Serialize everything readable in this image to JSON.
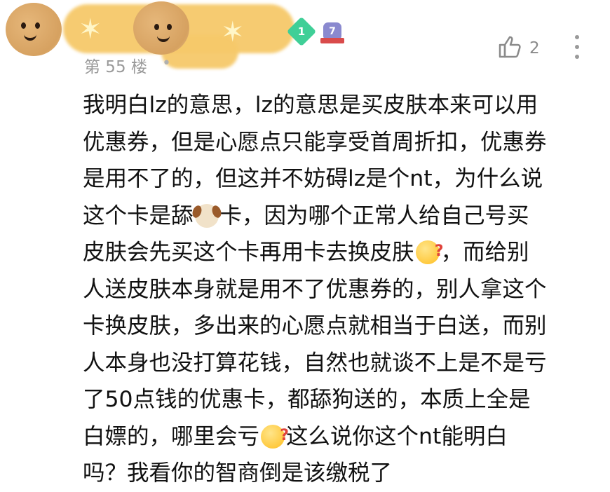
{
  "post": {
    "floor": "第 55 楼",
    "level_badge": "1",
    "rank_badge": "7",
    "likes": "2"
  },
  "body_lines": [
    [
      "我明白lz的意思，lz的意思是买皮肤本来可以用"
    ],
    [
      "优惠券，但是心愿点只能享受首周折扣，优惠券"
    ],
    [
      "是用不了的，但这并不妨碍lz是个nt，为什么说"
    ],
    [
      "这个卡是舔",
      "卡，因为哪个正常人给自己号买"
    ],
    [
      "皮肤会先买这个卡再用卡去换皮肤",
      "，而给别"
    ],
    [
      "人送皮肤本身就是用不了优惠券的，别人拿这个"
    ],
    [
      "卡换皮肤，多出来的心愿点就相当于白送，而别"
    ],
    [
      "人本身也没打算花钱，自然也就谈不上是不是亏"
    ],
    [
      "了50点钱的优惠卡，都舔狗送的，本质上全是"
    ],
    [
      "白嫖的，哪里会亏",
      "这么说你这个nt能明白"
    ],
    [
      "吗？我看你的智商倒是该缴税了"
    ]
  ],
  "icons": {
    "dog": "dog-face-emoji",
    "thinking": "thinking-face-emoji",
    "like": "thumbs-up-icon",
    "more": "more-vertical-icon"
  }
}
